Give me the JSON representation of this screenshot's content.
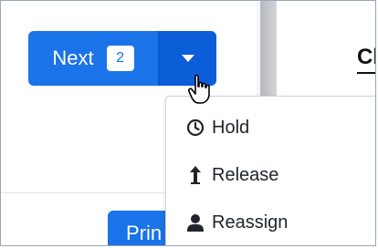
{
  "toolbar": {
    "next_label": "Next",
    "next_count": "2",
    "print_label": "Prin"
  },
  "header": {
    "title_fragment": "Cl"
  },
  "dropdown": {
    "items": [
      {
        "label": "Hold",
        "icon": "clock-icon"
      },
      {
        "label": "Release",
        "icon": "upload-arrow-icon"
      },
      {
        "label": "Reassign",
        "icon": "user-icon"
      }
    ]
  },
  "colors": {
    "primary": "#1a73e8",
    "primary_dark": "#0b5ed7"
  }
}
